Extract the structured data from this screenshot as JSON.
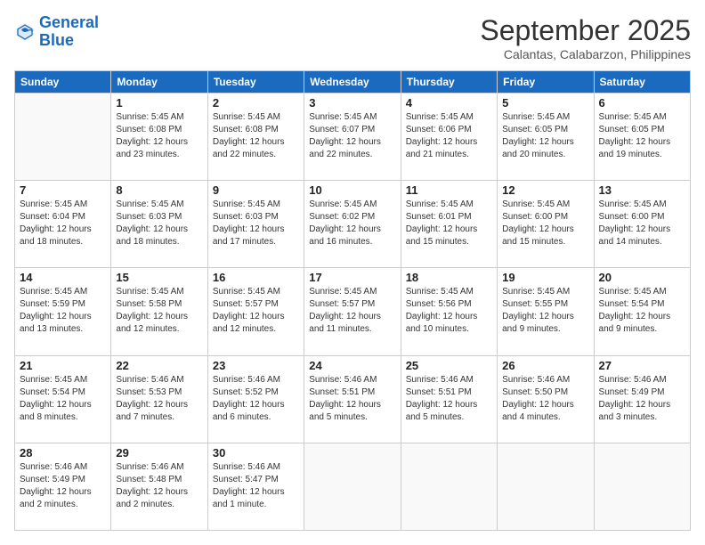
{
  "header": {
    "logo_line1": "General",
    "logo_line2": "Blue",
    "month": "September 2025",
    "location": "Calantas, Calabarzon, Philippines"
  },
  "weekdays": [
    "Sunday",
    "Monday",
    "Tuesday",
    "Wednesday",
    "Thursday",
    "Friday",
    "Saturday"
  ],
  "weeks": [
    [
      {
        "day": "",
        "info": ""
      },
      {
        "day": "1",
        "info": "Sunrise: 5:45 AM\nSunset: 6:08 PM\nDaylight: 12 hours\nand 23 minutes."
      },
      {
        "day": "2",
        "info": "Sunrise: 5:45 AM\nSunset: 6:08 PM\nDaylight: 12 hours\nand 22 minutes."
      },
      {
        "day": "3",
        "info": "Sunrise: 5:45 AM\nSunset: 6:07 PM\nDaylight: 12 hours\nand 22 minutes."
      },
      {
        "day": "4",
        "info": "Sunrise: 5:45 AM\nSunset: 6:06 PM\nDaylight: 12 hours\nand 21 minutes."
      },
      {
        "day": "5",
        "info": "Sunrise: 5:45 AM\nSunset: 6:05 PM\nDaylight: 12 hours\nand 20 minutes."
      },
      {
        "day": "6",
        "info": "Sunrise: 5:45 AM\nSunset: 6:05 PM\nDaylight: 12 hours\nand 19 minutes."
      }
    ],
    [
      {
        "day": "7",
        "info": "Sunrise: 5:45 AM\nSunset: 6:04 PM\nDaylight: 12 hours\nand 18 minutes."
      },
      {
        "day": "8",
        "info": "Sunrise: 5:45 AM\nSunset: 6:03 PM\nDaylight: 12 hours\nand 18 minutes."
      },
      {
        "day": "9",
        "info": "Sunrise: 5:45 AM\nSunset: 6:03 PM\nDaylight: 12 hours\nand 17 minutes."
      },
      {
        "day": "10",
        "info": "Sunrise: 5:45 AM\nSunset: 6:02 PM\nDaylight: 12 hours\nand 16 minutes."
      },
      {
        "day": "11",
        "info": "Sunrise: 5:45 AM\nSunset: 6:01 PM\nDaylight: 12 hours\nand 15 minutes."
      },
      {
        "day": "12",
        "info": "Sunrise: 5:45 AM\nSunset: 6:00 PM\nDaylight: 12 hours\nand 15 minutes."
      },
      {
        "day": "13",
        "info": "Sunrise: 5:45 AM\nSunset: 6:00 PM\nDaylight: 12 hours\nand 14 minutes."
      }
    ],
    [
      {
        "day": "14",
        "info": "Sunrise: 5:45 AM\nSunset: 5:59 PM\nDaylight: 12 hours\nand 13 minutes."
      },
      {
        "day": "15",
        "info": "Sunrise: 5:45 AM\nSunset: 5:58 PM\nDaylight: 12 hours\nand 12 minutes."
      },
      {
        "day": "16",
        "info": "Sunrise: 5:45 AM\nSunset: 5:57 PM\nDaylight: 12 hours\nand 12 minutes."
      },
      {
        "day": "17",
        "info": "Sunrise: 5:45 AM\nSunset: 5:57 PM\nDaylight: 12 hours\nand 11 minutes."
      },
      {
        "day": "18",
        "info": "Sunrise: 5:45 AM\nSunset: 5:56 PM\nDaylight: 12 hours\nand 10 minutes."
      },
      {
        "day": "19",
        "info": "Sunrise: 5:45 AM\nSunset: 5:55 PM\nDaylight: 12 hours\nand 9 minutes."
      },
      {
        "day": "20",
        "info": "Sunrise: 5:45 AM\nSunset: 5:54 PM\nDaylight: 12 hours\nand 9 minutes."
      }
    ],
    [
      {
        "day": "21",
        "info": "Sunrise: 5:45 AM\nSunset: 5:54 PM\nDaylight: 12 hours\nand 8 minutes."
      },
      {
        "day": "22",
        "info": "Sunrise: 5:46 AM\nSunset: 5:53 PM\nDaylight: 12 hours\nand 7 minutes."
      },
      {
        "day": "23",
        "info": "Sunrise: 5:46 AM\nSunset: 5:52 PM\nDaylight: 12 hours\nand 6 minutes."
      },
      {
        "day": "24",
        "info": "Sunrise: 5:46 AM\nSunset: 5:51 PM\nDaylight: 12 hours\nand 5 minutes."
      },
      {
        "day": "25",
        "info": "Sunrise: 5:46 AM\nSunset: 5:51 PM\nDaylight: 12 hours\nand 5 minutes."
      },
      {
        "day": "26",
        "info": "Sunrise: 5:46 AM\nSunset: 5:50 PM\nDaylight: 12 hours\nand 4 minutes."
      },
      {
        "day": "27",
        "info": "Sunrise: 5:46 AM\nSunset: 5:49 PM\nDaylight: 12 hours\nand 3 minutes."
      }
    ],
    [
      {
        "day": "28",
        "info": "Sunrise: 5:46 AM\nSunset: 5:49 PM\nDaylight: 12 hours\nand 2 minutes."
      },
      {
        "day": "29",
        "info": "Sunrise: 5:46 AM\nSunset: 5:48 PM\nDaylight: 12 hours\nand 2 minutes."
      },
      {
        "day": "30",
        "info": "Sunrise: 5:46 AM\nSunset: 5:47 PM\nDaylight: 12 hours\nand 1 minute."
      },
      {
        "day": "",
        "info": ""
      },
      {
        "day": "",
        "info": ""
      },
      {
        "day": "",
        "info": ""
      },
      {
        "day": "",
        "info": ""
      }
    ]
  ]
}
